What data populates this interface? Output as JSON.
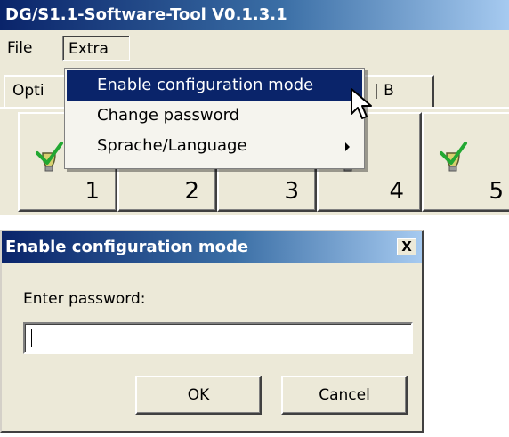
{
  "app": {
    "title": "DG/S1.1-Software-Tool V0.1.3.1",
    "menu": {
      "file": "File",
      "extra": "Extra"
    },
    "tabs": [
      {
        "label": "Opti"
      },
      {
        "label": "| B"
      }
    ],
    "buttons": [
      {
        "number": "1",
        "icon": "checkmark-bulb-icon"
      },
      {
        "number": "2",
        "icon": ""
      },
      {
        "number": "3",
        "icon": ""
      },
      {
        "number": "4",
        "icon": "checkmark-bulb-icon"
      },
      {
        "number": "5",
        "icon": "checkmark-bulb-icon"
      }
    ]
  },
  "dropdown": {
    "items": [
      {
        "label": "Enable configuration mode",
        "highlighted": true
      },
      {
        "label": "Change password",
        "highlighted": false
      },
      {
        "label": "Sprache/Language",
        "highlighted": false,
        "submenu": true
      }
    ]
  },
  "dialog": {
    "title": "Enable configuration mode",
    "close_label": "X",
    "prompt": "Enter password:",
    "password_value": "",
    "ok_label": "OK",
    "cancel_label": "Cancel"
  },
  "colors": {
    "titlebar_start": "#0a246a",
    "titlebar_end": "#a6caf0",
    "highlight": "#0a246a",
    "face": "#ece9d8",
    "check_green": "#22a832"
  }
}
